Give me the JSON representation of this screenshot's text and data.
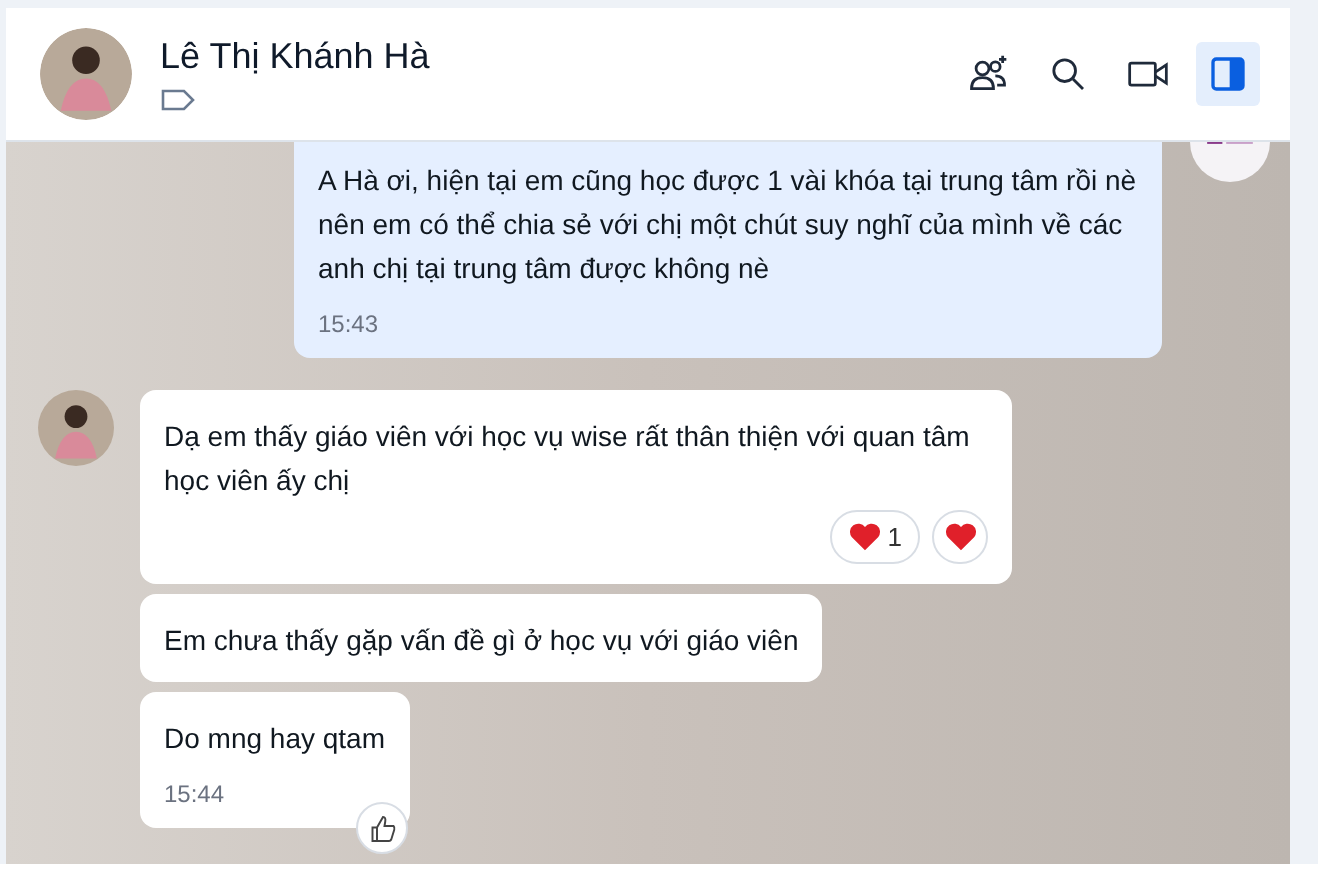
{
  "header": {
    "name": "Lê Thị Khánh Hà",
    "tag": true,
    "actions": [
      {
        "kind": "add-member",
        "selected": false
      },
      {
        "kind": "search",
        "selected": false
      },
      {
        "kind": "video",
        "selected": false
      },
      {
        "kind": "panel",
        "selected": true
      }
    ]
  },
  "messages": [
    {
      "kind": "sent",
      "avatar": true,
      "text": "A Hà ơi, hiện tại em cũng học được 1 vài khóa tại trung tâm rồi nè nên em có thể chia sẻ với chị một chút suy nghĩ của mình về các anh chị tại trung tâm được không nè",
      "time": "15:43"
    },
    {
      "kind": "received",
      "avatar": true,
      "text": "Dạ em thấy giáo viên với học vụ wise rất thân thiện với quan tâm học viên ấy chị",
      "reactions": [
        {
          "kind": "heart",
          "count": "1"
        }
      ],
      "react_button": {
        "kind": "heart"
      }
    },
    {
      "kind": "received",
      "avatar": false,
      "text": "Em chưa thấy gặp vấn đề gì ở học vụ với giáo viên"
    },
    {
      "kind": "received",
      "avatar": false,
      "text": "Do mng hay qtam",
      "time": "15:44",
      "react_button": {
        "kind": "like"
      }
    }
  ]
}
